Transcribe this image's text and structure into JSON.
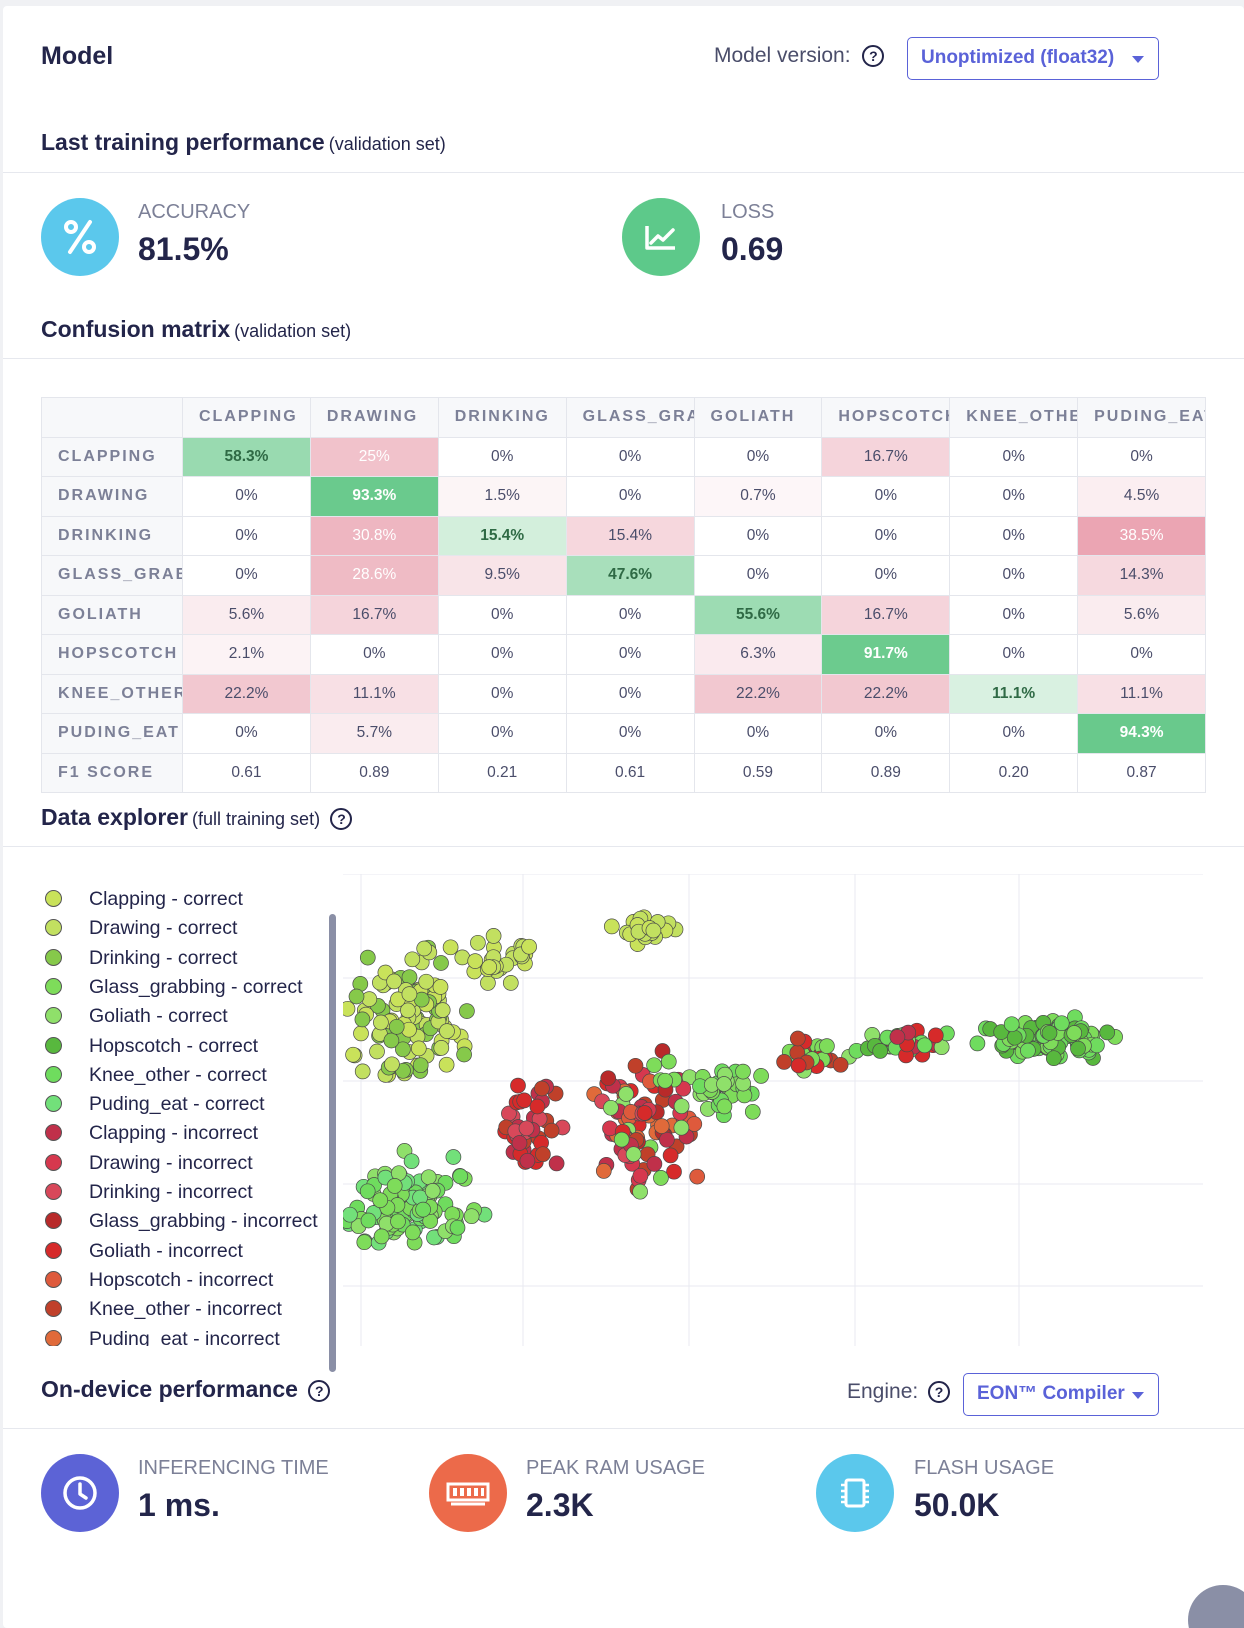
{
  "header": {
    "title": "Model",
    "version_label": "Model version:",
    "version_value": "Unoptimized (float32)"
  },
  "training": {
    "title": "Last training performance",
    "subtitle": "(validation set)",
    "accuracy_label": "ACCURACY",
    "accuracy_value": "81.5%",
    "loss_label": "LOSS",
    "loss_value": "0.69",
    "accuracy_icon": "percent-icon",
    "loss_icon": "chart-trend-icon",
    "accuracy_color": "#5bc8ec",
    "loss_color": "#5dc98a"
  },
  "confusion": {
    "title": "Confusion matrix",
    "subtitle": "(validation set)",
    "columns": [
      "CLAPPING",
      "DRAWING",
      "DRINKING",
      "GLASS_GRAB",
      "GOLIATH",
      "HOPSCOTCH",
      "KNEE_OTHER",
      "PUDING_EAT"
    ],
    "rows": [
      {
        "label": "CLAPPING",
        "cells": [
          "58.3%",
          "25%",
          "0%",
          "0%",
          "0%",
          "16.7%",
          "0%",
          "0%"
        ]
      },
      {
        "label": "DRAWING",
        "cells": [
          "0%",
          "93.3%",
          "1.5%",
          "0%",
          "0.7%",
          "0%",
          "0%",
          "4.5%"
        ]
      },
      {
        "label": "DRINKING",
        "cells": [
          "0%",
          "30.8%",
          "15.4%",
          "15.4%",
          "0%",
          "0%",
          "0%",
          "38.5%"
        ]
      },
      {
        "label": "GLASS_GRABBING",
        "cells": [
          "0%",
          "28.6%",
          "9.5%",
          "47.6%",
          "0%",
          "0%",
          "0%",
          "14.3%"
        ]
      },
      {
        "label": "GOLIATH",
        "cells": [
          "5.6%",
          "16.7%",
          "0%",
          "0%",
          "55.6%",
          "16.7%",
          "0%",
          "5.6%"
        ]
      },
      {
        "label": "HOPSCOTCH",
        "cells": [
          "2.1%",
          "0%",
          "0%",
          "0%",
          "6.3%",
          "91.7%",
          "0%",
          "0%"
        ]
      },
      {
        "label": "KNEE_OTHER",
        "cells": [
          "22.2%",
          "11.1%",
          "0%",
          "0%",
          "22.2%",
          "22.2%",
          "11.1%",
          "11.1%"
        ]
      },
      {
        "label": "PUDING_EAT",
        "cells": [
          "0%",
          "5.7%",
          "0%",
          "0%",
          "0%",
          "0%",
          "0%",
          "94.3%"
        ]
      }
    ],
    "f1_label": "F1 SCORE",
    "f1": [
      "0.61",
      "0.89",
      "0.21",
      "0.61",
      "0.59",
      "0.89",
      "0.20",
      "0.87"
    ]
  },
  "explorer": {
    "title": "Data explorer",
    "subtitle": "(full training set)",
    "legend": [
      {
        "label": "Clapping - correct",
        "color": "#c9e25a"
      },
      {
        "label": "Drawing - correct",
        "color": "#c2e060"
      },
      {
        "label": "Drinking - correct",
        "color": "#86c94a"
      },
      {
        "label": "Glass_grabbing - correct",
        "color": "#7edc5a"
      },
      {
        "label": "Goliath - correct",
        "color": "#8fe06a"
      },
      {
        "label": "Hopscotch - correct",
        "color": "#58b83e"
      },
      {
        "label": "Knee_other - correct",
        "color": "#6fdc5e"
      },
      {
        "label": "Puding_eat - correct",
        "color": "#72e07a"
      },
      {
        "label": "Clapping - incorrect",
        "color": "#c0304a"
      },
      {
        "label": "Drawing - incorrect",
        "color": "#d6384e"
      },
      {
        "label": "Drinking - incorrect",
        "color": "#d8485a"
      },
      {
        "label": "Glass_grabbing - incorrect",
        "color": "#b82a2a"
      },
      {
        "label": "Goliath - incorrect",
        "color": "#d62a2a"
      },
      {
        "label": "Hopscotch - incorrect",
        "color": "#de5a3c"
      },
      {
        "label": "Knee_other - incorrect",
        "color": "#c0402a"
      },
      {
        "label": "Puding_eat - incorrect",
        "color": "#e06a3a"
      }
    ]
  },
  "ondevice": {
    "title": "On-device performance",
    "engine_label": "Engine:",
    "engine_value": "EON™ Compiler",
    "metrics": [
      {
        "label": "INFERENCING TIME",
        "value": "1 ms.",
        "icon": "clock-icon",
        "color": "#5c63d6"
      },
      {
        "label": "PEAK RAM USAGE",
        "value": "2.3K",
        "icon": "memory-icon",
        "color": "#ec6a4a"
      },
      {
        "label": "FLASH USAGE",
        "value": "50.0K",
        "icon": "chip-icon",
        "color": "#5bc8ec"
      }
    ]
  }
}
